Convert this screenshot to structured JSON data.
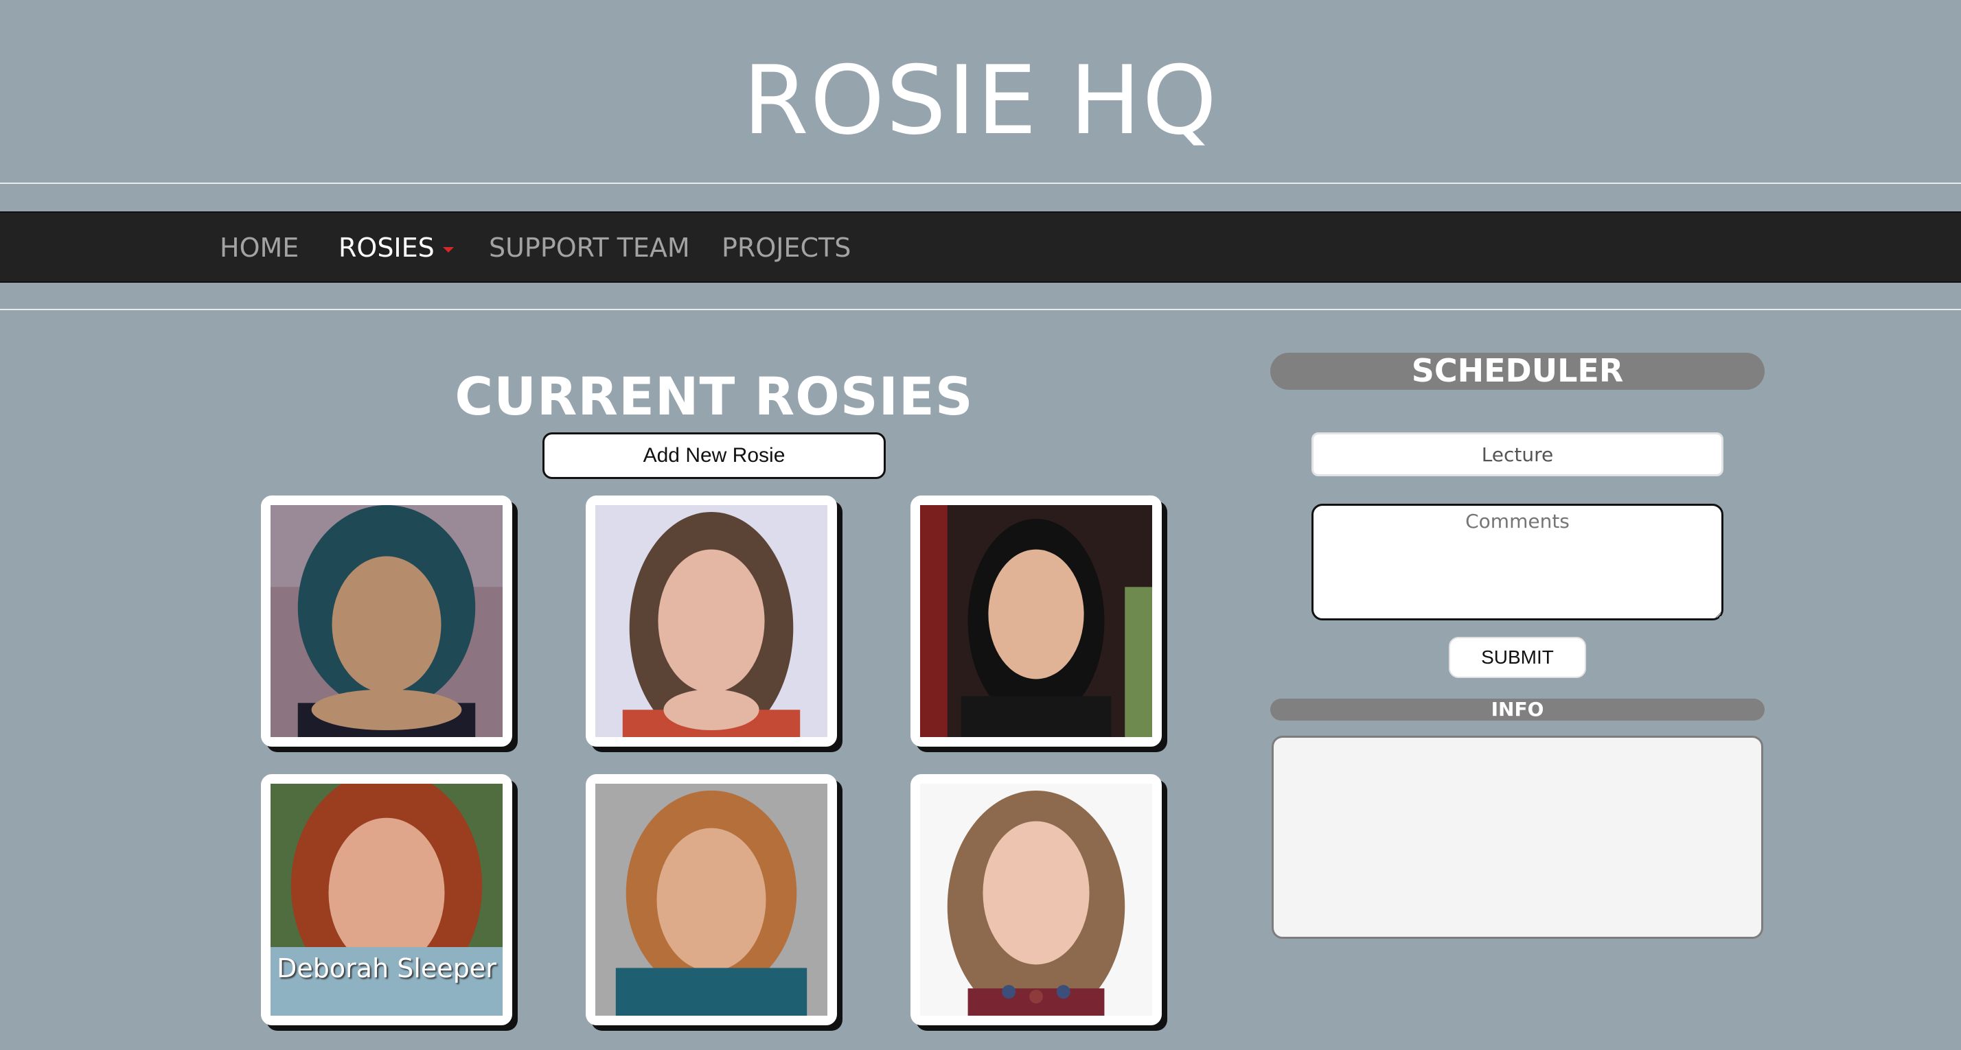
{
  "site": {
    "title": "ROSIE HQ"
  },
  "nav": {
    "items": [
      {
        "label": "HOME",
        "active": false
      },
      {
        "label": "ROSIES",
        "active": true,
        "dropdown": true
      },
      {
        "label": "SUPPORT TEAM",
        "active": false
      },
      {
        "label": "PROJECTS",
        "active": false
      }
    ]
  },
  "main": {
    "title": "CURRENT ROSIES",
    "add_button_label": "Add New Rosie",
    "rosies": [
      {
        "name": ""
      },
      {
        "name": ""
      },
      {
        "name": ""
      },
      {
        "name": "Deborah Sleeper"
      },
      {
        "name": ""
      },
      {
        "name": ""
      }
    ]
  },
  "scheduler": {
    "title": "SCHEDULER",
    "event_type_value": "Lecture",
    "comments_placeholder": "Comments",
    "submit_label": "SUBMIT",
    "info_title": "INFO"
  },
  "colors": {
    "page_bg": "#96a4ad",
    "navbar_bg": "#222222",
    "nav_caret": "#d9262b",
    "panel_header_bg": "#808080",
    "name_overlay_bg": "#8fb2c3"
  }
}
